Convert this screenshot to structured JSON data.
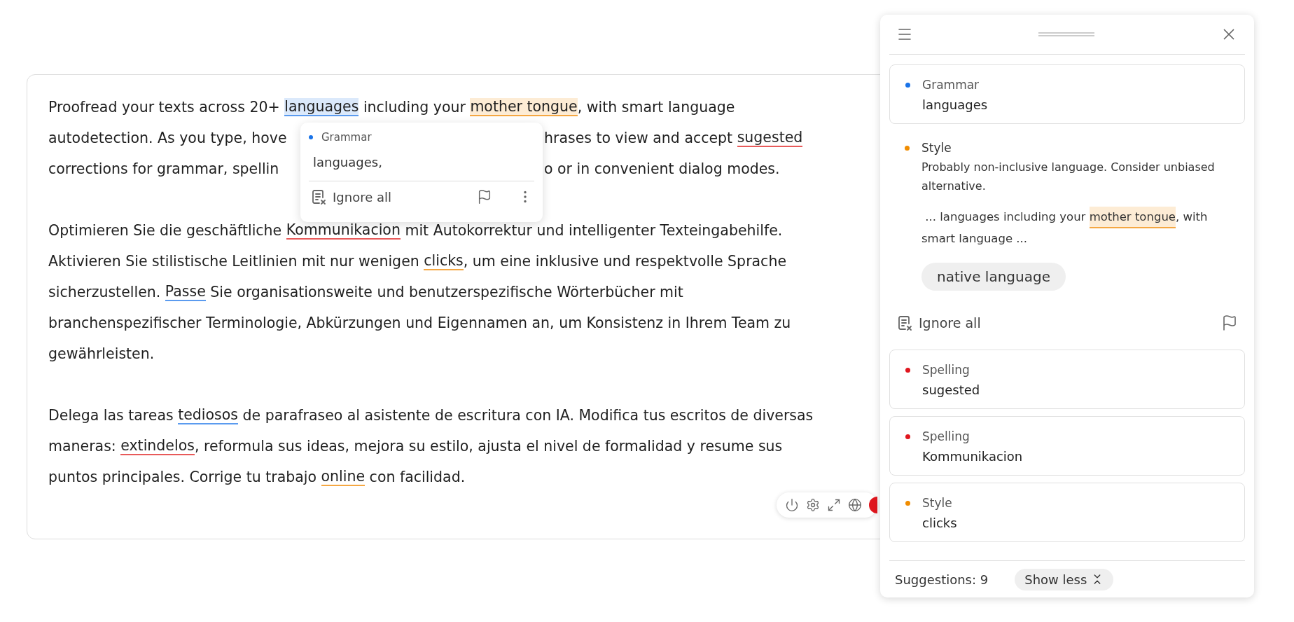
{
  "editor": {
    "paragraphs": [
      {
        "lines": [
          {
            "segments": [
              {
                "text": "Proofread your texts across 20+ "
              },
              {
                "text": "languages",
                "color": "#5b9bef",
                "highlighted": true
              },
              {
                "text": " including your "
              },
              {
                "text": "mother tongue",
                "color": "#f5a742",
                "highlighted": true
              },
              {
                "text": ", with smart language"
              }
            ]
          },
          {
            "segments": [
              {
                "text": "autodetection. As you type, hove"
              }
            ],
            "resume": [
              {
                "text": "hrases to view and accept "
              },
              {
                "text": "sugested",
                "color": "#e85a5a",
                "highlighted": false
              }
            ]
          },
          {
            "segments": [
              {
                "text": "corrections for grammar, spellin"
              }
            ],
            "resume": [
              {
                "text": "o or in convenient dialog modes."
              }
            ]
          }
        ]
      },
      {
        "lines": [
          {
            "segments": [
              {
                "text": "Optimieren Sie die geschäftliche "
              },
              {
                "text": "Kommunikacion",
                "color": "#e85a5a",
                "highlighted": false
              },
              {
                "text": " mit Autokorrektur und intelligenter Texteingabehilfe."
              }
            ]
          },
          {
            "segments": [
              {
                "text": "Aktivieren Sie stilistische Leitlinien mit nur wenigen "
              },
              {
                "text": "clicks",
                "color": "#f5a742",
                "highlighted": false
              },
              {
                "text": ", um eine inklusive und respektvolle Sprache"
              }
            ]
          },
          {
            "segments": [
              {
                "text": "sicherzustellen. "
              },
              {
                "text": "Passe",
                "color": "#5b9bef",
                "highlighted": false
              },
              {
                "text": " Sie organisationsweite und benutzerspezifische Wörterbücher mit"
              }
            ]
          },
          {
            "segments": [
              {
                "text": "branchenspezifischer Terminologie, Abkürzungen und Eigennamen an, um Konsistenz in Ihrem Team zu"
              }
            ]
          },
          {
            "segments": [
              {
                "text": "gewährleisten."
              }
            ]
          }
        ]
      },
      {
        "lines": [
          {
            "segments": [
              {
                "text": "Delega las tareas "
              },
              {
                "text": "tediosos",
                "color": "#5b9bef",
                "highlighted": false
              },
              {
                "text": " de parafraseo al asistente de escritura con IA. Modifica tus escritos de diversas"
              }
            ]
          },
          {
            "segments": [
              {
                "text": "maneras: "
              },
              {
                "text": "extindelos",
                "color": "#e85a5a",
                "highlighted": false
              },
              {
                "text": ", reformula sus ideas, mejora su estilo, ajusta el nivel de formalidad y resume sus"
              }
            ]
          },
          {
            "segments": [
              {
                "text": "puntos principales. Corrige tu trabajo "
              },
              {
                "text": "online",
                "color": "#f5a742",
                "highlighted": false
              },
              {
                "text": " con facilidad."
              }
            ]
          }
        ]
      }
    ]
  },
  "popup": {
    "category": "Grammar",
    "color": "#1a73e8",
    "suggestion": "languages,",
    "action": "Ignore all"
  },
  "panel": {
    "items": [
      {
        "kind": "card",
        "category": "Grammar",
        "color": "#1a73e8",
        "text": "languages"
      },
      {
        "kind": "expanded",
        "category": "Style",
        "color": "#f08c00",
        "message": "Probably non-inclusive language. Consider unbiased alternative.",
        "context": [
          [
            {
              "text": " ... languages including your "
            },
            {
              "text": "mother tongue",
              "color": "#f5a742",
              "highlighted": true
            },
            {
              "text": ", with"
            }
          ],
          [
            {
              "text": "smart language ..."
            }
          ]
        ],
        "suggestion": "native language",
        "action": "Ignore all"
      },
      {
        "kind": "card",
        "category": "Spelling",
        "color": "#e0161e",
        "text": "sugested"
      },
      {
        "kind": "card",
        "category": "Spelling",
        "color": "#e0161e",
        "text": "Kommunikacion"
      },
      {
        "kind": "card",
        "category": "Style",
        "color": "#f08c00",
        "text": "clicks"
      }
    ],
    "footer": {
      "count": "Suggestions: 9",
      "toggle": "Show less"
    }
  }
}
